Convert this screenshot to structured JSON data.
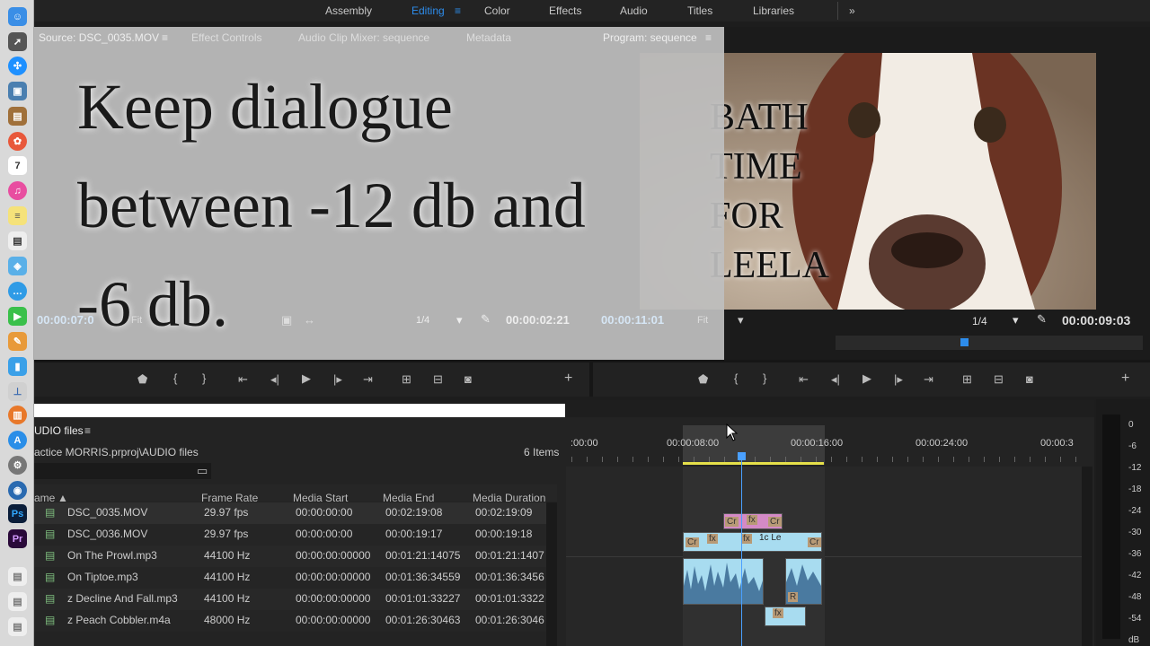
{
  "workspace": {
    "tabs": [
      "Assembly",
      "Editing",
      "Color",
      "Effects",
      "Audio",
      "Titles",
      "Libraries"
    ],
    "active": "Editing",
    "more": "»"
  },
  "source_panel": {
    "tabs": [
      "Source: DSC_0035.MOV",
      "Effect Controls",
      "Audio Clip Mixer: sequence",
      "Metadata"
    ],
    "timecode": "00:00:07:0",
    "fit": "Fit",
    "fraction": "1/4",
    "duration": "00:00:02:21"
  },
  "program_panel": {
    "tab": "Program: sequence",
    "timecode": "00:00:11:01",
    "fit": "Fit",
    "fraction": "1/4",
    "duration": "00:00:09:03",
    "title_lines": [
      "Bath",
      "Time",
      "For",
      "Leela"
    ]
  },
  "overlay_caption": {
    "lines": [
      "Keep dialogue",
      "between -12 db and",
      "-6 db."
    ]
  },
  "project": {
    "title": "UDIO files",
    "path": "actice MORRIS.prproj\\AUDIO files",
    "count": "6 Items",
    "columns": [
      "ame",
      "Frame Rate",
      "Media Start",
      "Media End",
      "Media Duration"
    ],
    "rows": [
      {
        "name": "DSC_0035.MOV",
        "rate": "29.97 fps",
        "start": "00:00:00:00",
        "end": "00:02:19:08",
        "dur": "00:02:19:09"
      },
      {
        "name": "DSC_0036.MOV",
        "rate": "29.97 fps",
        "start": "00:00:00:00",
        "end": "00:00:19:17",
        "dur": "00:00:19:18"
      },
      {
        "name": "On The Prowl.mp3",
        "rate": "44100 Hz",
        "start": "00:00:00:00000",
        "end": "00:01:21:14075",
        "dur": "00:01:21:1407"
      },
      {
        "name": "On Tiptoe.mp3",
        "rate": "44100 Hz",
        "start": "00:00:00:00000",
        "end": "00:01:36:34559",
        "dur": "00:01:36:3456"
      },
      {
        "name": "z Decline And Fall.mp3",
        "rate": "44100 Hz",
        "start": "00:00:00:00000",
        "end": "00:01:01:33227",
        "dur": "00:01:01:3322"
      },
      {
        "name": "z Peach Cobbler.m4a",
        "rate": "48000 Hz",
        "start": "00:00:00:00000",
        "end": "00:01:26:30463",
        "dur": "00:01:26:3046"
      }
    ]
  },
  "timeline": {
    "ruler": [
      ":00:00",
      "00:00:08:00",
      "00:00:16:00",
      "00:00:24:00",
      "00:00:3"
    ],
    "clip_labels": {
      "cr": "Cr",
      "fx": "fx",
      "le": "1c Le",
      "r": "R"
    }
  },
  "meter": {
    "labels": [
      "0",
      "-6",
      "-12",
      "-18",
      "-24",
      "-30",
      "-36",
      "-42",
      "-48",
      "-54",
      "dB"
    ]
  }
}
